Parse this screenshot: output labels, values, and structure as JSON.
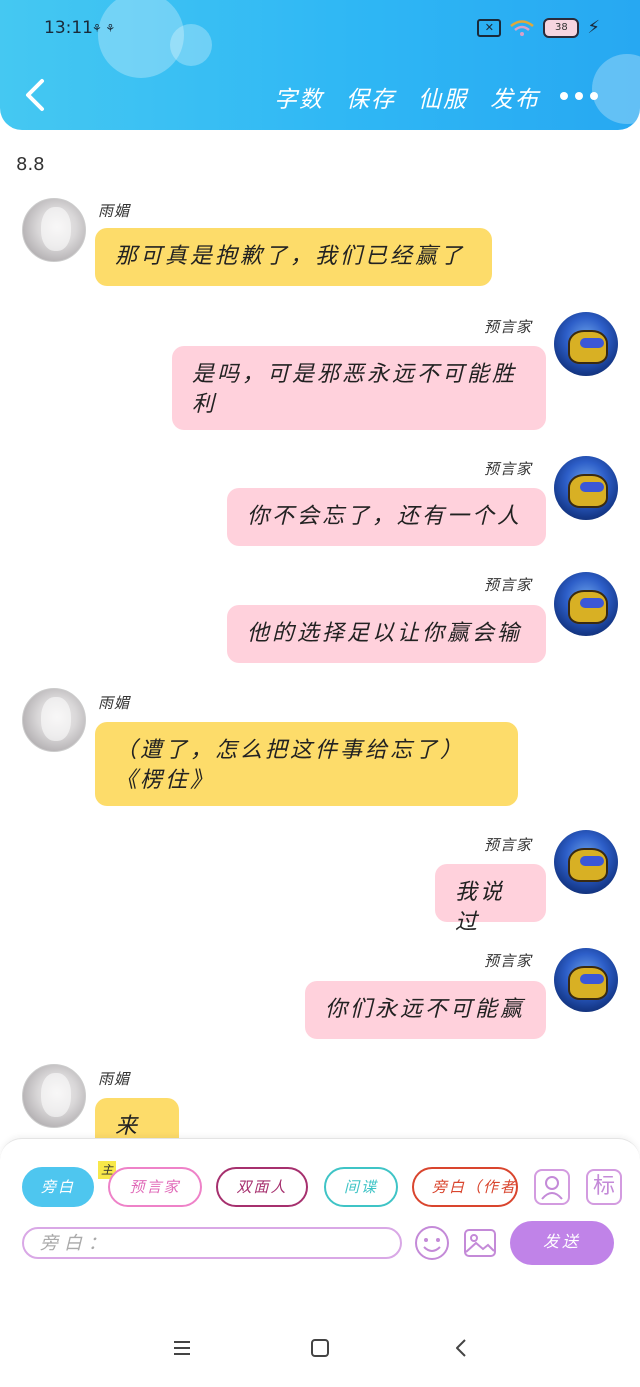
{
  "status_bar": {
    "time": "13:11",
    "extra_icons": "⚘ ⚘",
    "sim_icon": "close-box-icon",
    "battery_level": "38"
  },
  "header": {
    "actions": [
      "字数",
      "保存",
      "仙服",
      "发布"
    ],
    "back_icon": "chevron-left-icon",
    "more_icon": "more-dots-icon",
    "gradient": [
      "#45c8f2",
      "#27a8f2"
    ]
  },
  "chat": {
    "date": "8.8",
    "messages": [
      {
        "side": "left",
        "name": "雨媚",
        "text": "那可真是抱歉了，我们已经赢了"
      },
      {
        "side": "right",
        "name": "预言家",
        "text": "是吗，可是邪恶永远不可能胜利"
      },
      {
        "side": "right",
        "name": "预言家",
        "text": "你不会忘了，还有一个人"
      },
      {
        "side": "right",
        "name": "预言家",
        "text": "他的选择足以让你赢会输"
      },
      {
        "side": "left",
        "name": "雨媚",
        "text": "（遭了，怎么把这件事给忘了）《楞住》"
      },
      {
        "side": "right",
        "name": "预言家",
        "text": "我说过"
      },
      {
        "side": "right",
        "name": "预言家",
        "text": "你们永远不可能赢"
      },
      {
        "side": "left",
        "name": "雨媚",
        "text": "来人"
      }
    ],
    "colors": {
      "left_bubble": "#fddc6a",
      "right_bubble": "#ffd1dc"
    }
  },
  "composer": {
    "roles": [
      "旁白",
      "预言家",
      "双面人",
      "间谍",
      "旁白（作者）"
    ],
    "main_badge": "主",
    "role_icon": "user-card-icon",
    "tag_label": "标",
    "input_placeholder": "旁白：",
    "emoji_icon": "smiley-icon",
    "image_icon": "image-icon",
    "send_label": "发送",
    "send_color": "#c083e8"
  },
  "navbar": {
    "items": [
      "menu-icon",
      "home-square-icon",
      "back-triangle-icon"
    ]
  }
}
